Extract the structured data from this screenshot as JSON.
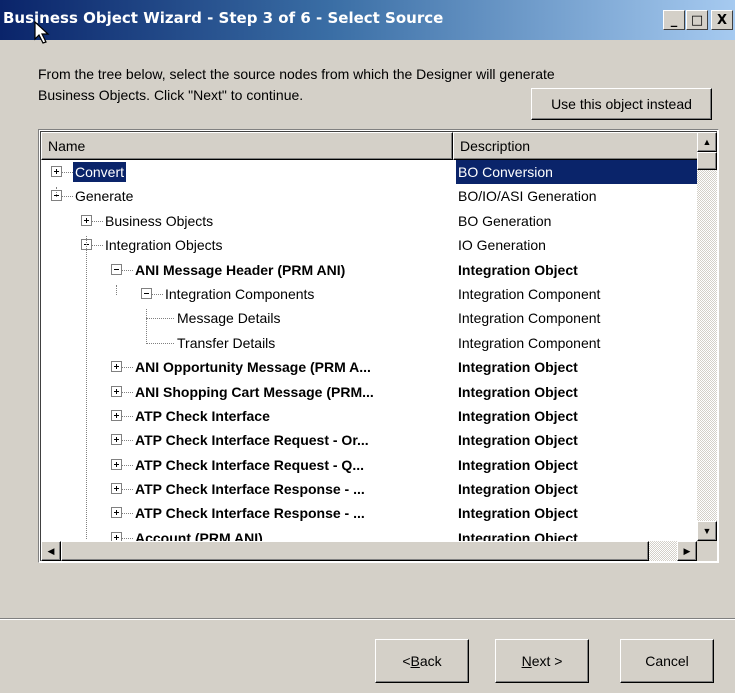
{
  "window": {
    "title": "Business Object Wizard - Step 3 of 6 - Select Source",
    "controls": {
      "minimize": "_",
      "maximize": "□",
      "close": "X"
    }
  },
  "instructions": {
    "line1": "From the tree below, select the source nodes from which the Designer will generate",
    "line2": "Business Objects. Click \"Next\" to continue."
  },
  "use_object_button": "Use this object instead",
  "tree": {
    "columns": [
      "Name",
      "Description"
    ],
    "rows": [
      {
        "name": "Convert",
        "description": "BO Conversion",
        "level": 0,
        "toggle": "plus",
        "bold": false,
        "selected": true
      },
      {
        "name": "Generate",
        "description": "BO/IO/ASI Generation",
        "level": 0,
        "toggle": "minus",
        "bold": false,
        "selected": false
      },
      {
        "name": "Business Objects",
        "description": "BO Generation",
        "level": 1,
        "toggle": "plus",
        "bold": false,
        "selected": false
      },
      {
        "name": "Integration Objects",
        "description": "IO Generation",
        "level": 1,
        "toggle": "minus",
        "bold": false,
        "selected": false
      },
      {
        "name": "ANI Message Header (PRM ANI)",
        "description": "Integration Object",
        "level": 2,
        "toggle": "minus",
        "bold": true,
        "selected": false
      },
      {
        "name": "Integration Components",
        "description": "Integration Component",
        "level": 3,
        "toggle": "minus",
        "bold": false,
        "selected": false
      },
      {
        "name": "Message Details",
        "description": "Integration Component",
        "level": 4,
        "toggle": "none",
        "bold": false,
        "selected": false
      },
      {
        "name": "Transfer Details",
        "description": "Integration Component",
        "level": 4,
        "toggle": "none",
        "bold": false,
        "selected": false
      },
      {
        "name": "ANI Opportunity Message (PRM A...",
        "description": "Integration Object",
        "level": 2,
        "toggle": "plus",
        "bold": true,
        "selected": false
      },
      {
        "name": "ANI Shopping Cart Message (PRM...",
        "description": "Integration Object",
        "level": 2,
        "toggle": "plus",
        "bold": true,
        "selected": false
      },
      {
        "name": "ATP Check Interface",
        "description": "Integration Object",
        "level": 2,
        "toggle": "plus",
        "bold": true,
        "selected": false
      },
      {
        "name": "ATP Check Interface Request - Or...",
        "description": "Integration Object",
        "level": 2,
        "toggle": "plus",
        "bold": true,
        "selected": false
      },
      {
        "name": "ATP Check Interface Request - Q...",
        "description": "Integration Object",
        "level": 2,
        "toggle": "plus",
        "bold": true,
        "selected": false
      },
      {
        "name": "ATP Check Interface Response - ...",
        "description": "Integration Object",
        "level": 2,
        "toggle": "plus",
        "bold": true,
        "selected": false
      },
      {
        "name": "ATP Check Interface Response - ...",
        "description": "Integration Object",
        "level": 2,
        "toggle": "plus",
        "bold": true,
        "selected": false
      },
      {
        "name": "Account (PRM ANI)",
        "description": "Integration Object",
        "level": 2,
        "toggle": "plus",
        "bold": true,
        "selected": false
      }
    ]
  },
  "buttons": {
    "back": {
      "prefix": "< ",
      "mnemonic": "B",
      "rest": "ack"
    },
    "next": {
      "mnemonic": "N",
      "rest": "ext >"
    },
    "cancel": "Cancel"
  }
}
